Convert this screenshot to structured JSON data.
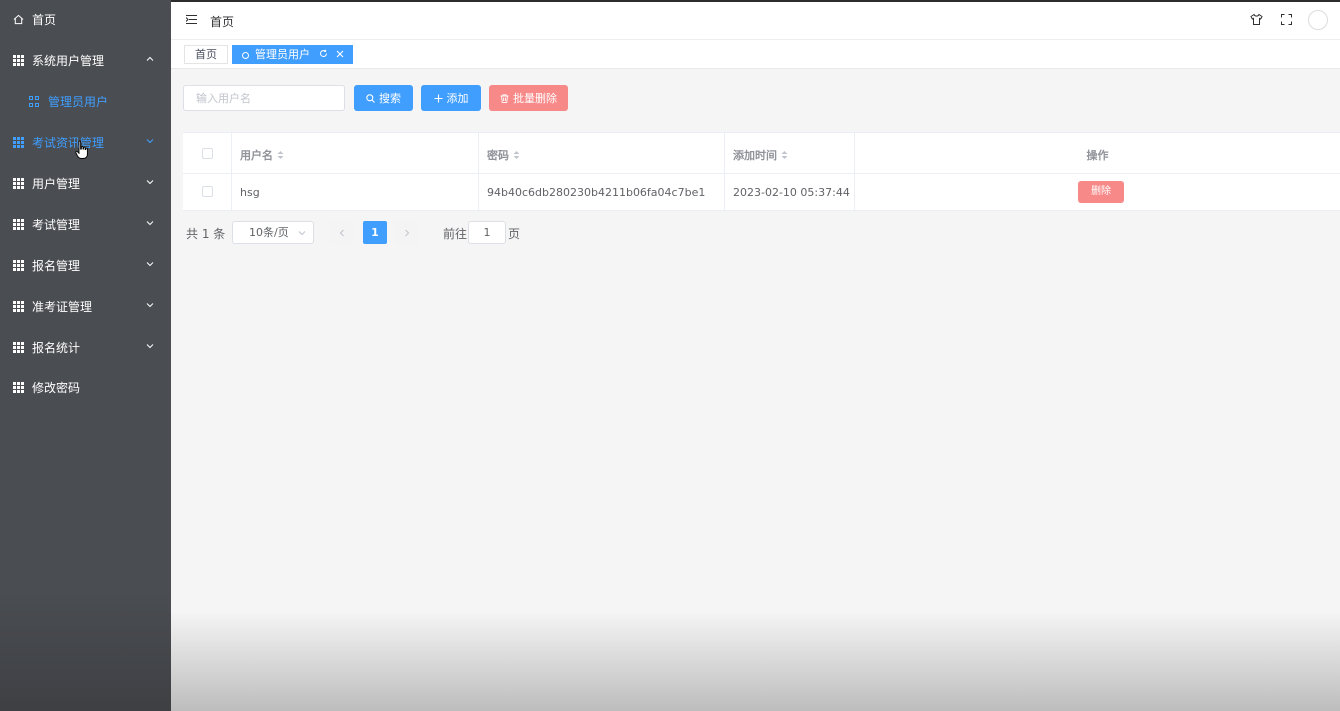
{
  "sidebar": {
    "items": [
      {
        "label": "首页",
        "icon": "home-icon"
      },
      {
        "label": "系统用户管理",
        "icon": "grid-icon",
        "expanded": true
      },
      {
        "label": "管理员用户",
        "icon": "apps-icon"
      },
      {
        "label": "考试资讯管理",
        "icon": "grid-icon"
      },
      {
        "label": "用户管理",
        "icon": "grid-icon"
      },
      {
        "label": "考试管理",
        "icon": "grid-icon"
      },
      {
        "label": "报名管理",
        "icon": "grid-icon"
      },
      {
        "label": "准考证管理",
        "icon": "grid-icon"
      },
      {
        "label": "报名统计",
        "icon": "grid-icon"
      },
      {
        "label": "修改密码",
        "icon": "grid-icon"
      }
    ]
  },
  "header": {
    "breadcrumb": "首页"
  },
  "tags": [
    {
      "label": "首页"
    },
    {
      "label": "管理员用户"
    }
  ],
  "toolbar": {
    "search_placeholder": "输入用户名",
    "search_label": "搜索",
    "add_label": "添加",
    "batch_delete_label": "批量删除"
  },
  "table": {
    "headers": [
      "用户名",
      "密码",
      "添加时间",
      "操作"
    ],
    "rows": [
      {
        "username": "hsg",
        "password": "94b40c6db280230b4211b06fa04c7be1",
        "added": "2023-02-10 05:37:44",
        "action": "删除"
      }
    ]
  },
  "pagination": {
    "total": "共 1 条",
    "page_size": "10条/页",
    "current": "1",
    "goto_label": "前往",
    "goto_value": "1",
    "goto_suffix": "页"
  },
  "colors": {
    "primary": "#409eff",
    "danger": "#f78989",
    "sidebar": "#4a4d51"
  }
}
